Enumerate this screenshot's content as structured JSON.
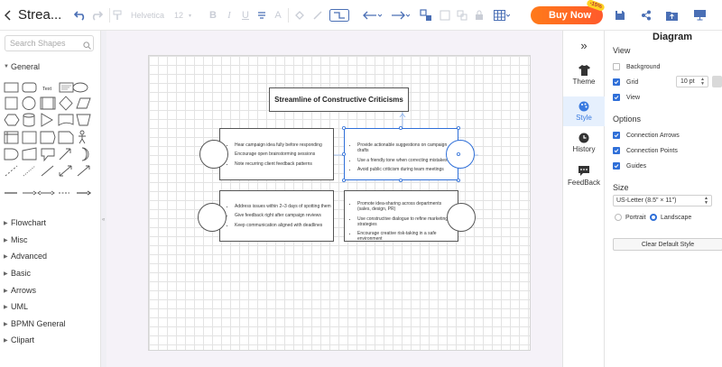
{
  "toolbar": {
    "title": "Strea...",
    "font_family": "Helvetica",
    "font_size": "12",
    "buy_label": "Buy Now",
    "buy_badge": "-15%"
  },
  "left_panel": {
    "search_placeholder": "Search Shapes",
    "general_label": "General",
    "text_shape_label": "Text",
    "categories": [
      "Flowchart",
      "Misc",
      "Advanced",
      "Basic",
      "Arrows",
      "UML",
      "BPMN General",
      "Clipart"
    ]
  },
  "diagram": {
    "title": "Streamline of Constructive Criticisms",
    "cards": [
      {
        "bullets": [
          "Hear campaign idea fully before responding",
          "Encourage open brainstorming sessions",
          "Note recurring client feedback patterns"
        ]
      },
      {
        "bullets": [
          "Provide actionable suggestions on campaign drafts",
          "Use a friendly tone when correcting mistakes",
          "Avoid public criticism during team meetings"
        ]
      },
      {
        "bullets": [
          "Address issues within 2–3 days of spotting them",
          "Give feedback right after campaign reviews",
          "Keep communication aligned with deadlines"
        ]
      },
      {
        "bullets": [
          "Promote idea-sharing across departments (sales, design, PR)",
          "Use constructive dialogue to refine marketing strategies",
          "Encourage creative risk-taking in a safe environment"
        ]
      }
    ]
  },
  "side_tabs": [
    {
      "label": "Theme",
      "icon": "shirt-icon"
    },
    {
      "label": "Style",
      "icon": "palette-icon",
      "active": true
    },
    {
      "label": "History",
      "icon": "clock-icon"
    },
    {
      "label": "FeedBack",
      "icon": "chat-icon"
    }
  ],
  "properties": {
    "title": "Diagram",
    "view_label": "View",
    "background_label": "Background",
    "background_checked": false,
    "grid_label": "Grid",
    "grid_checked": true,
    "grid_size": "10 pt",
    "view_checkbox_label": "View",
    "view_checked": true,
    "options_label": "Options",
    "connection_arrows_label": "Connection Arrows",
    "connection_points_label": "Connection Points",
    "guides_label": "Guides",
    "size_label": "Size",
    "paper_size": "US-Letter (8.5\" × 11\")",
    "portrait_label": "Portrait",
    "landscape_label": "Landscape",
    "orientation": "landscape",
    "clear_default_style": "Clear Default Style"
  },
  "colors": {
    "accent": "#2f6fd8",
    "buy_button": "#ff6a22",
    "toolbar_icon": "#4a6fb5"
  }
}
